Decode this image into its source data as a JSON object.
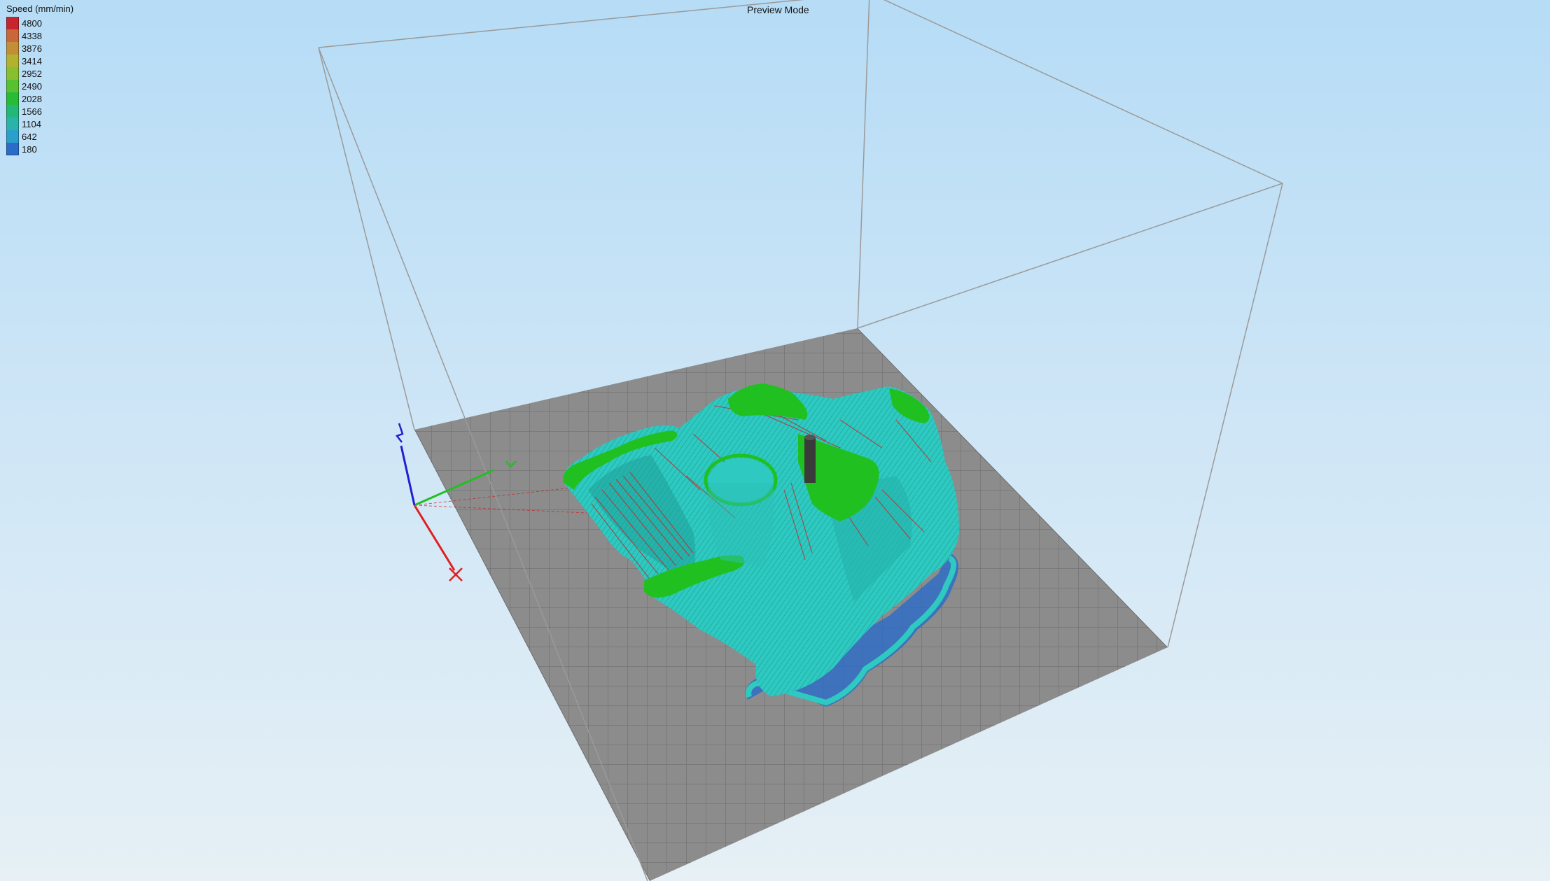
{
  "viewer": {
    "title": "Preview Mode"
  },
  "legend": {
    "title": "Speed (mm/min)",
    "items": [
      {
        "label": "4800",
        "color": "#c8242e"
      },
      {
        "label": "4338",
        "color": "#c9663a"
      },
      {
        "label": "3876",
        "color": "#c28f36"
      },
      {
        "label": "3414",
        "color": "#b3b22e"
      },
      {
        "label": "2952",
        "color": "#88bf2e"
      },
      {
        "label": "2490",
        "color": "#56c22f"
      },
      {
        "label": "2028",
        "color": "#27bb37"
      },
      {
        "label": "1566",
        "color": "#22b877"
      },
      {
        "label": "1104",
        "color": "#2ab4a9"
      },
      {
        "label": "642",
        "color": "#2a9fcb"
      },
      {
        "label": "180",
        "color": "#2a6cc8"
      }
    ]
  },
  "scene": {
    "axes": [
      {
        "name": "X",
        "color": "#e02020"
      },
      {
        "name": "Y",
        "color": "#20c020"
      },
      {
        "name": "Z",
        "color": "#2020d0"
      }
    ],
    "bed_color": "#8c8c8c",
    "model_colors": {
      "walls": "#2ec9c0",
      "tops": "#21c021",
      "travel": "#cc1f1f",
      "support": "#2a6cc8"
    }
  }
}
